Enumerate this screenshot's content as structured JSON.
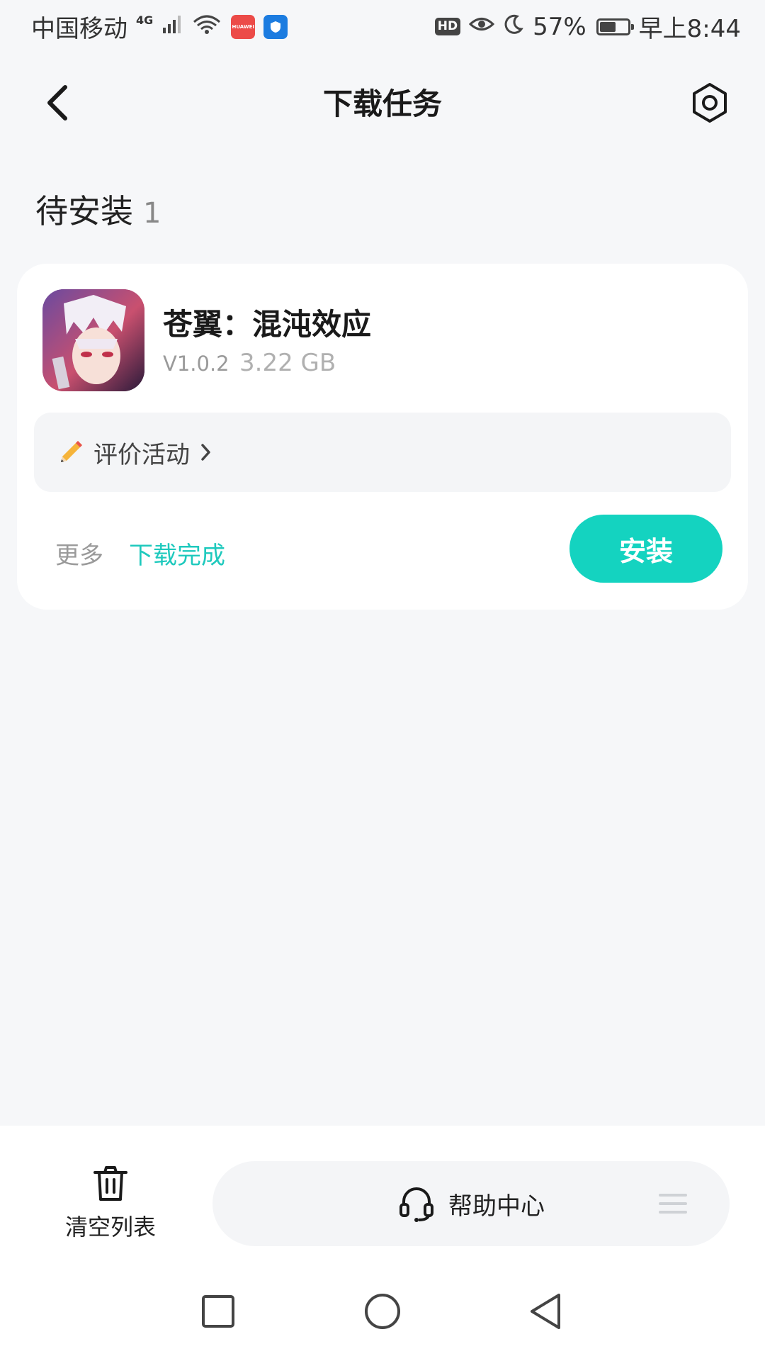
{
  "status_bar": {
    "carrier": "中国移动",
    "network": "4G",
    "battery_percent": "57%",
    "battery_level": 0.57,
    "time": "早上8:44",
    "hd_label": "HD",
    "huawei_label": "HUAWEI"
  },
  "nav": {
    "title": "下载任务"
  },
  "section": {
    "title": "待安装",
    "count": "1"
  },
  "task": {
    "app_name": "苍翼：混沌效应",
    "version": "V1.0.2",
    "size": "3.22 GB",
    "promo_label": "评价活动",
    "more_label": "更多",
    "status": "下载完成",
    "install_label": "安装"
  },
  "bottom_bar": {
    "clear_label": "清空列表",
    "help_label": "帮助中心"
  },
  "colors": {
    "accent": "#14d3c0",
    "status_text": "#1ec9bd",
    "background": "#f6f7f9"
  },
  "icons": {
    "back": "back-arrow-icon",
    "settings": "settings-hexagon-icon",
    "promo": "pencil-icon",
    "chevron": "chevron-right-icon",
    "trash": "trash-icon",
    "headset": "headset-icon",
    "menu": "menu-lines-icon"
  }
}
